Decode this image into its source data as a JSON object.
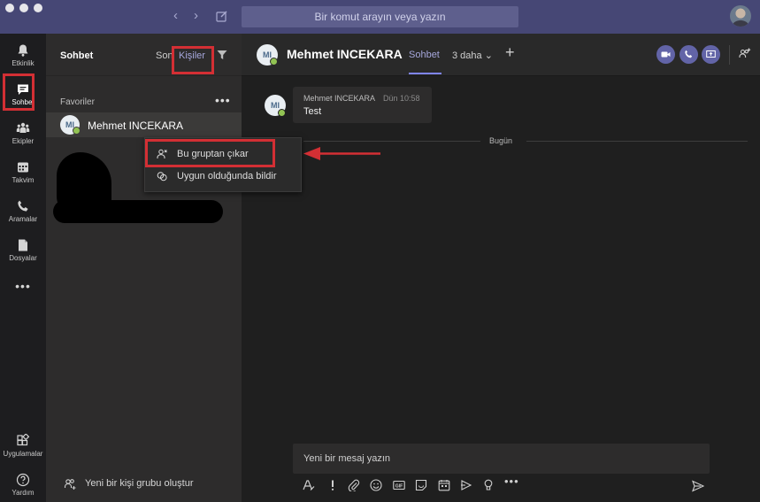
{
  "titlebar": {
    "search_placeholder": "Bir komut arayın veya yazın"
  },
  "rail": {
    "items": [
      {
        "label": "Etkinlik"
      },
      {
        "label": "Sohbet"
      },
      {
        "label": "Ekipler"
      },
      {
        "label": "Takvim"
      },
      {
        "label": "Aramalar"
      },
      {
        "label": "Dosyalar"
      }
    ],
    "more": "•••",
    "apps_label": "Uygulamalar",
    "help_label": "Yardım"
  },
  "chatlist": {
    "title": "Sohbet",
    "tab_recent": "Son",
    "tab_contacts": "Kişiler",
    "favorites_label": "Favoriler",
    "favorites_more": "•••",
    "contact": {
      "initials": "MI",
      "name": "Mehmet INCEKARA"
    },
    "new_group_label": "Yeni bir kişi grubu oluştur"
  },
  "context_menu": {
    "items": [
      {
        "label": "Bu gruptan çıkar",
        "icon": "person-remove-icon"
      },
      {
        "label": "Uygun olduğunda bildir",
        "icon": "notify-availability-icon"
      }
    ]
  },
  "main": {
    "header": {
      "initials": "MI",
      "name": "Mehmet INCEKARA",
      "tab_chat": "Sohbet",
      "tab_more": "3 daha",
      "add": "+"
    },
    "message": {
      "initials": "MI",
      "sender": "Mehmet INCEKARA",
      "time": "Dün 10:58",
      "text": "Test"
    },
    "day_divider": "Bugün",
    "compose_placeholder": "Yeni bir mesaj yazın"
  },
  "colors": {
    "accent": "#6264a7",
    "titlebar": "#464775",
    "presence": "#92c353",
    "highlight": "#d32f34"
  }
}
